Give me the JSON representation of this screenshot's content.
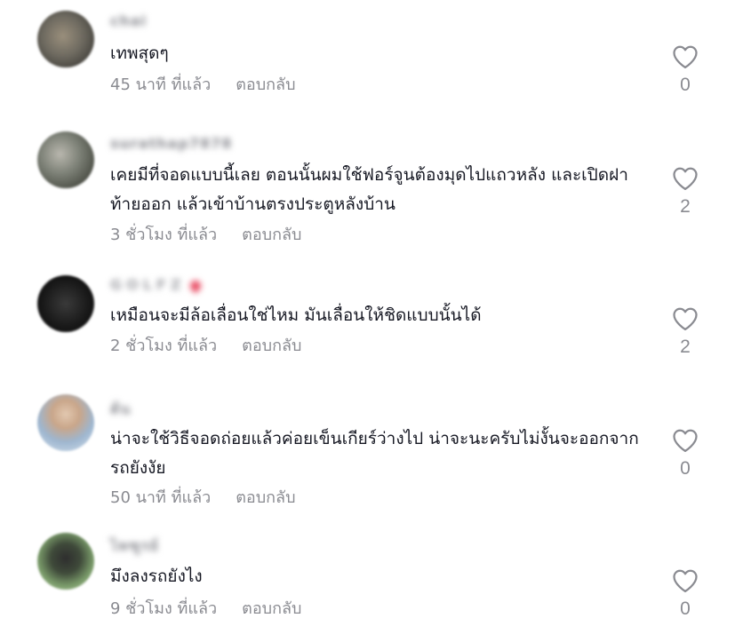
{
  "comments": [
    {
      "username": "chai",
      "text": "เทพสุดๆ",
      "time": "45 นาที ที่แล้ว",
      "reply": "ตอบกลับ",
      "likes": "0"
    },
    {
      "username": "surathap7878",
      "text": "เคยมีที่จอดแบบนี้เลย ตอนนั้นผมใช้ฟอร์จูนต้องมุดไปแถวหลัง และเปิดฝาท้ายออก แล้วเข้าบ้านตรงประตูหลังบ้าน",
      "time": "3 ชั่วโมง ที่แล้ว",
      "reply": "ตอบกลับ",
      "likes": "2"
    },
    {
      "username": "GOLFZ",
      "text": "เหมือนจะมีล้อเลื่อนใช่ไหม มันเลื่อนให้ชิดแบบนั้นได้",
      "time": "2 ชั่วโมง ที่แล้ว",
      "reply": "ตอบกลับ",
      "likes": "2"
    },
    {
      "username": "ต้น",
      "text": "น่าจะใช้วิธีจอดถ่อยแล้วค่อยเข็นเกียร์ว่างไป น่าจะนะครับไม่งั้นจะออกจากรถยังงัย",
      "time": "50 นาที ที่แล้ว",
      "reply": "ตอบกลับ",
      "likes": "0"
    },
    {
      "username": "ไพฑูรย์",
      "text": "มึงลงรถยังไง",
      "time": "9 ชั่วโมง ที่แล้ว",
      "reply": "ตอบกลับ",
      "likes": "0"
    }
  ],
  "colors": {
    "text": "#161823",
    "secondary": "#8a8b91",
    "heart_outline": "#8a8b91"
  },
  "icons": {
    "like": "heart-outline-icon"
  }
}
